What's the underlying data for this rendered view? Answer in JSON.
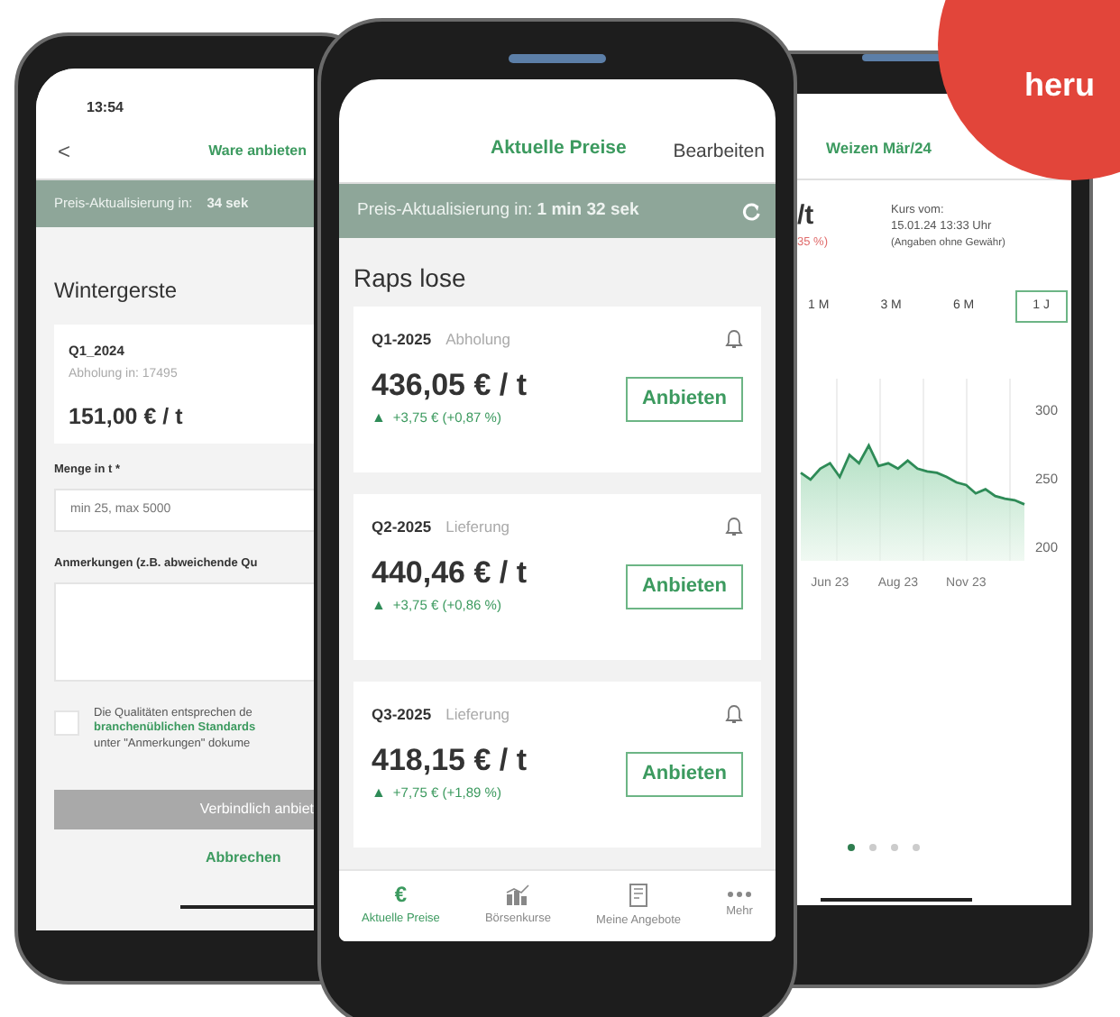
{
  "badge": {
    "text": "heru"
  },
  "offer_screen": {
    "time": "13:54",
    "back": "<",
    "title": "Ware anbieten",
    "update_label": "Preis-Aktualisierung in:",
    "update_value": "34 sek",
    "product": "Wintergerste",
    "offer": {
      "period": "Q1_2024",
      "pickup": "Abholung in: 17495",
      "price": "151,00 € / t"
    },
    "quantity": {
      "label": "Menge in t *",
      "placeholder": "min 25, max 5000"
    },
    "notes": {
      "label": "Anmerkungen (z.B. abweichende Qu"
    },
    "confirm": {
      "checked": false,
      "lines": [
        "Die Qualitäten entsprechen de",
        "branchenüblichen Standards",
        "unter \"Anmerkungen\" dokume"
      ]
    },
    "submit": {
      "label": "Verbindlich anbiet",
      "disabled": true
    },
    "cancel": "Abbrechen"
  },
  "prices_screen": {
    "title": "Aktuelle Preise",
    "edit": "Bearbeiten",
    "update_text": "Preis-Aktualisierung in: **1 min  32 sek**",
    "product": "Raps lose",
    "offers": [
      {
        "period": "Q1-2025",
        "type": "Abholung",
        "price": "436,05 € / t",
        "trend": "▲",
        "change": "+3,75 € (+0,87 %)",
        "button": "Anbieten"
      },
      {
        "period": "Q2-2025",
        "type": "Lieferung",
        "price": "440,46 € / t",
        "trend": "▲",
        "change": "+3,75 € (+0,86 %)",
        "button": "Anbieten"
      },
      {
        "period": "Q3-2025",
        "type": "Lieferung",
        "price": "418,15 € / t",
        "trend": "▲",
        "change": "+7,75 € (+1,89 %)",
        "button": "Anbieten"
      }
    ],
    "tabs": [
      {
        "kind": "euro",
        "icon": "€",
        "label": "Aktuelle Preise",
        "selected": true
      },
      {
        "kind": "chart",
        "label": "Börsenkurse",
        "selected": false
      },
      {
        "kind": "document",
        "label": "Meine Angebote",
        "selected": false
      },
      {
        "kind": "more",
        "label": "Mehr",
        "selected": false
      }
    ]
  },
  "chart_screen": {
    "title": "Weizen Mär/24",
    "price": "/t",
    "change": "35 %)",
    "rate_label": "Kurs vom:",
    "rate_date": "15.01.24 13:33 Uhr",
    "disclaimer": "(Angaben ohne Gewähr)",
    "ranges": [
      {
        "label": "1 M",
        "selected": false
      },
      {
        "label": "3 M",
        "selected": false
      },
      {
        "label": "6 M",
        "selected": false
      },
      {
        "label": "1 J",
        "selected": true
      }
    ],
    "chart_data": {
      "type": "area",
      "categories": [
        null,
        null,
        null,
        "Jun 23",
        null,
        null,
        null,
        null,
        null,
        null,
        "Aug 23",
        null,
        null,
        null,
        null,
        null,
        null,
        "Nov 23",
        null,
        null,
        null,
        null,
        null,
        null
      ],
      "yticks": [
        {
          "value": 200,
          "label": "200"
        },
        {
          "value": 250,
          "label": "250"
        },
        {
          "value": 300,
          "label": "300"
        }
      ],
      "ylim": [
        200,
        300
      ],
      "series": [
        {
          "color": "#2e8b57",
          "values": [
            255,
            250,
            258,
            262,
            252,
            268,
            262,
            275,
            260,
            262,
            258,
            264,
            258,
            256,
            255,
            252,
            248,
            246,
            240,
            243,
            238,
            236,
            235,
            232
          ]
        }
      ]
    },
    "pages": [
      {
        "selected": true
      },
      {
        "selected": false
      },
      {
        "selected": false
      },
      {
        "selected": false
      }
    ]
  }
}
